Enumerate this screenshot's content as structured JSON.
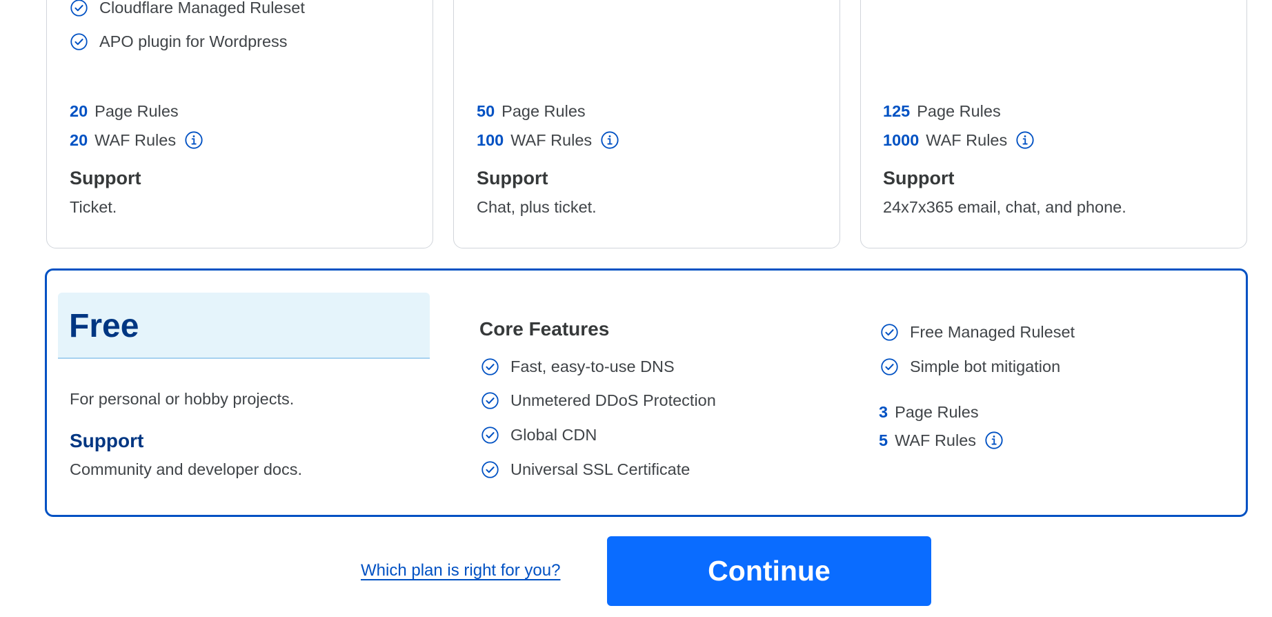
{
  "colors": {
    "accent": "#0051c3",
    "button": "#0a6cff",
    "free_header_bg": "#e5f4fb",
    "text": "#404448"
  },
  "plans": [
    {
      "features": [
        "Cloudflare Managed Ruleset",
        "APO plugin for Wordpress"
      ],
      "page_rules_count": "20",
      "page_rules_label": "Page Rules",
      "waf_rules_count": "20",
      "waf_rules_label": "WAF Rules",
      "support_heading": "Support",
      "support_text": "Ticket."
    },
    {
      "page_rules_count": "50",
      "page_rules_label": "Page Rules",
      "waf_rules_count": "100",
      "waf_rules_label": "WAF Rules",
      "support_heading": "Support",
      "support_text": "Chat, plus ticket."
    },
    {
      "page_rules_count": "125",
      "page_rules_label": "Page Rules",
      "waf_rules_count": "1000",
      "waf_rules_label": "WAF Rules",
      "support_heading": "Support",
      "support_text": "24x7x365 email, chat, and phone."
    }
  ],
  "free": {
    "title": "Free",
    "description": "For personal or hobby projects.",
    "support_heading": "Support",
    "support_text": "Community and developer docs.",
    "core_heading": "Core Features",
    "core_features": [
      "Fast, easy-to-use DNS",
      "Unmetered DDoS Protection",
      "Global CDN",
      "Universal SSL Certificate"
    ],
    "extra_features": [
      "Free Managed Ruleset",
      "Simple bot mitigation"
    ],
    "page_rules_count": "3",
    "page_rules_label": "Page Rules",
    "waf_rules_count": "5",
    "waf_rules_label": "WAF Rules"
  },
  "footer": {
    "help_link": "Which plan is right for you?",
    "continue_label": "Continue"
  },
  "icons": {
    "check": "check-circle-icon",
    "info": "info-circle-icon"
  }
}
